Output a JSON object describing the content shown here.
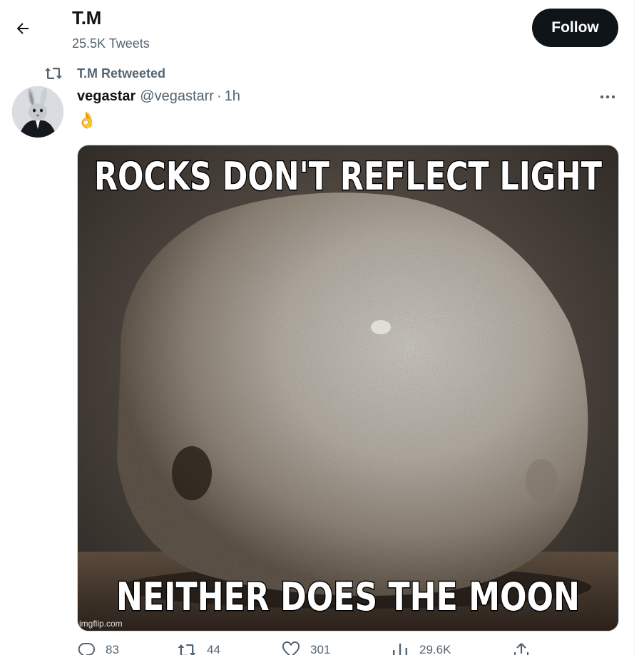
{
  "header": {
    "title": "T.M",
    "tweet_count": "25.5K Tweets",
    "follow_label": "Follow"
  },
  "retweet_context": {
    "label": "T.M Retweeted"
  },
  "tweet": {
    "display_name": "vegastar",
    "handle": "@vegastarr",
    "separator": "·",
    "time": "1h",
    "text": "👌",
    "media": {
      "top_caption": "ROCKS DON'T REFLECT LIGHT",
      "bottom_caption": "NEITHER DOES THE MOON",
      "watermark": "imgflip.com"
    },
    "actions": {
      "replies": "83",
      "retweets": "44",
      "likes": "301",
      "views": "29.6K"
    }
  },
  "icons": {
    "back": "back-arrow-icon",
    "retweet": "retweet-icon",
    "more": "more-horizontal-icon",
    "reply": "reply-icon",
    "like": "heart-icon",
    "views": "views-icon",
    "share": "share-icon"
  },
  "colors": {
    "text_primary": "#0f1419",
    "text_secondary": "#536471",
    "follow_bg": "#0f1419",
    "border": "#cfd9de"
  }
}
